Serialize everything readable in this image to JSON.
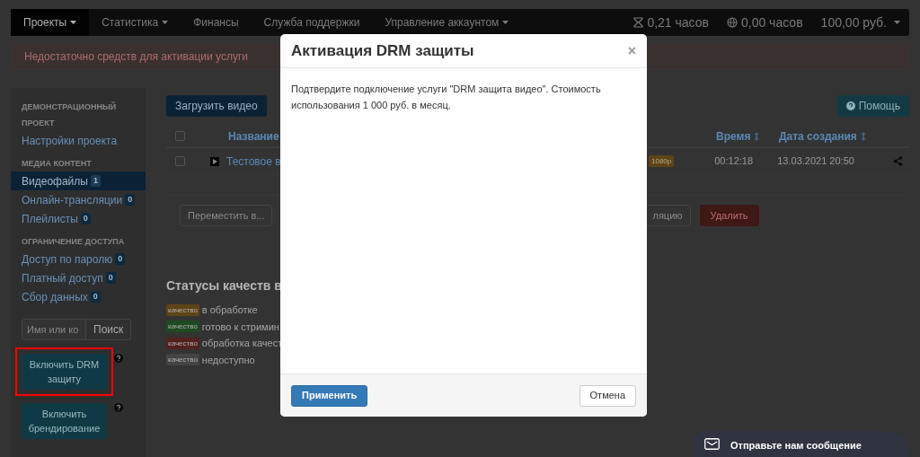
{
  "navbar": {
    "items": [
      {
        "label": "Проекты",
        "dropdown": true,
        "selected": true
      },
      {
        "label": "Статистика",
        "dropdown": true,
        "selected": false
      },
      {
        "label": "Финансы",
        "dropdown": false,
        "selected": false
      },
      {
        "label": "Служба поддержки",
        "dropdown": false,
        "selected": false
      },
      {
        "label": "Управление аккаунтом",
        "dropdown": true,
        "selected": false
      }
    ],
    "stats": [
      {
        "kind": "timer",
        "label": "0,21 часов",
        "dropdown": false
      },
      {
        "kind": "globe",
        "label": "0,00 часов",
        "dropdown": false
      },
      {
        "kind": "balance",
        "label": "100,00 руб.",
        "dropdown": true
      }
    ]
  },
  "alert": "Недостаточно средств для активации услуги",
  "sidebar": {
    "sections": [
      {
        "heading": "ДЕМОНСТРАЦИОННЫЙ ПРОЕКТ",
        "items": [
          {
            "label": "Настройки проекта",
            "selected": false
          }
        ]
      },
      {
        "heading": "МЕДИА КОНТЕНТ",
        "items": [
          {
            "label": "Видеофайлы",
            "count": "1",
            "selected": true
          },
          {
            "label": "Онлайн-трансляции",
            "count": "0",
            "selected": false
          },
          {
            "label": "Плейлисты",
            "count": "0",
            "selected": false
          }
        ]
      },
      {
        "heading": "ОГРАНИЧЕНИЕ ДОСТУПА",
        "items": [
          {
            "label": "Доступ по паролю",
            "count": "0",
            "selected": false
          },
          {
            "label": "Платный доступ",
            "count": "0",
            "selected": false
          },
          {
            "label": "Сбор данных",
            "count": "0",
            "selected": false
          }
        ]
      }
    ],
    "search": {
      "placeholder": "Имя или ко",
      "button": "Поиск"
    },
    "actions": [
      {
        "label": "Включить DRM защиту",
        "highlighted": true
      },
      {
        "label": "Включить брендирование",
        "highlighted": false
      }
    ]
  },
  "toolbar": {
    "upload": "Загрузить видео",
    "help": "Помощь"
  },
  "table": {
    "select_all_checked": false,
    "columns": [
      {
        "label": "Название",
        "sortable": false
      },
      {
        "label": "Время",
        "sortable": true
      },
      {
        "label": "Дата создания",
        "sortable": true
      }
    ],
    "rows": [
      {
        "checked": false,
        "title": "Тестовое в",
        "quality": "1080p",
        "duration": "00:12:18",
        "created": "13.03.2021 20:50"
      }
    ]
  },
  "bulk_actions": [
    {
      "label": "Переместить в...",
      "kind": "default"
    },
    {
      "label": "ляцию",
      "kind": "default"
    },
    {
      "label": "Удалить",
      "kind": "danger"
    }
  ],
  "statuses": {
    "title": "Статусы качеств в",
    "items": [
      {
        "label": "качество",
        "text": "в обработке",
        "color": "#5e4416"
      },
      {
        "label": "качество",
        "text": "готово к стримин",
        "color": "#1e4a22"
      },
      {
        "label": "качество",
        "text": "обработка качест",
        "color": "#52201e"
      },
      {
        "label": "качество",
        "text": "недоступно",
        "color": "#444444"
      }
    ]
  },
  "modal": {
    "title": "Активация DRM защиты",
    "close": "×",
    "body": "Подтвердите подключение услуги \"DRM защита видео\". Стоимость использования 1 000 руб. в месяц.",
    "buttons": [
      {
        "label": "Применить",
        "kind": "primary"
      },
      {
        "label": "Отмена",
        "kind": "default"
      }
    ]
  },
  "chat": {
    "label": "Отправьте нам сообщение"
  }
}
